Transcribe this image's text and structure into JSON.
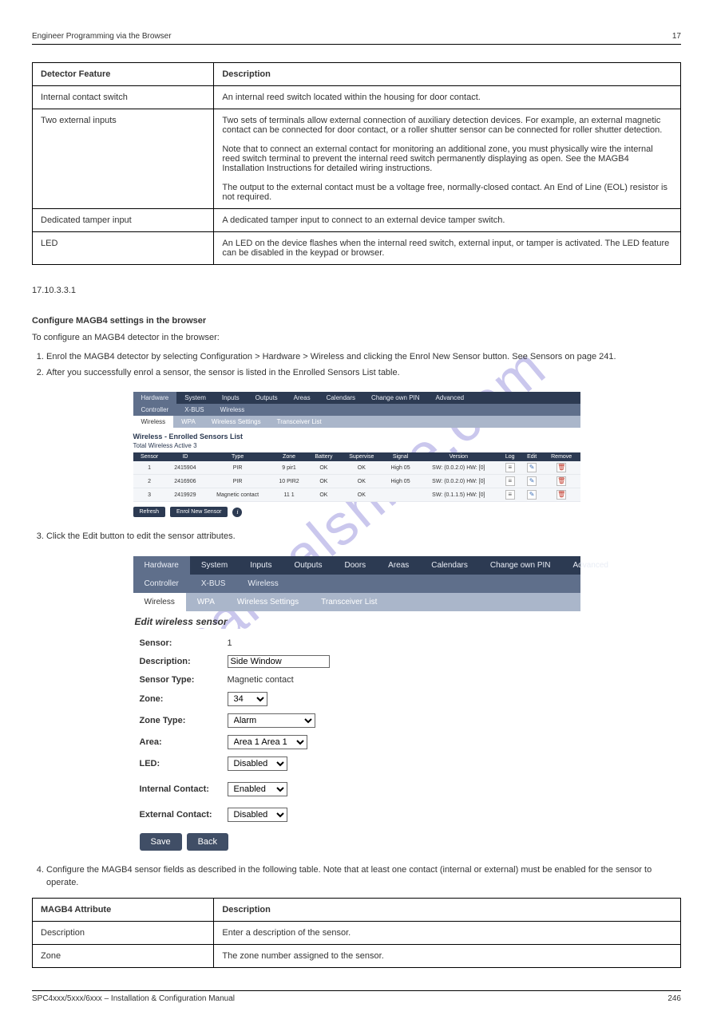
{
  "header": {
    "left": "Engineer Programming via the Browser",
    "right": "17"
  },
  "watermark": "manualshive.com",
  "table1": {
    "cols": [
      "Detector Feature",
      "Description"
    ],
    "rows": [
      [
        "Internal contact switch",
        "An internal reed switch located within the housing for door contact."
      ],
      [
        "Two external inputs",
        "Two sets of terminals allow external connection of auxiliary detection devices. For example, an external magnetic contact can be connected for door contact, or a roller shutter sensor can be connected for roller shutter detection.\n\nNote that to connect an external contact for monitoring an additional zone, you must physically wire the internal reed switch terminal to prevent the internal reed switch permanently displaying as open. See the MAGB4 Installation Instructions for detailed wiring instructions.\n\nThe output to the external contact must be a voltage free, normally-closed contact. An End of Line (EOL) resistor is not required."
      ],
      [
        "Dedicated tamper input",
        "A dedicated tamper input to connect to an external device tamper switch."
      ],
      [
        "LED",
        "An LED on the device flashes when the internal reed switch, external input, or tamper is activated. The LED feature can be disabled in the keypad or browser."
      ]
    ]
  },
  "section_label": "17.10.3.3.1",
  "section_title": "Configure MAGB4 settings in the browser",
  "intro": "To configure an MAGB4 detector in the browser:",
  "steps": [
    "Enrol the MAGB4 detector by selecting Configuration > Hardware > Wireless and clicking the Enrol New Sensor button. See Sensors on page 241.",
    "After you successfully enrol a sensor, the sensor is listed in the Enrolled Sensors List table."
  ],
  "screenshot1": {
    "nav1": [
      "Hardware",
      "System",
      "Inputs",
      "Outputs",
      "Areas",
      "Calendars",
      "Change own PIN",
      "Advanced"
    ],
    "nav1_active": "Hardware",
    "nav2": [
      "Controller",
      "X-BUS",
      "Wireless"
    ],
    "nav2_active": "Wireless",
    "nav3": [
      "Wireless",
      "WPA",
      "Wireless Settings",
      "Transceiver List"
    ],
    "nav3_active": "Wireless",
    "title": "Wireless - Enrolled Sensors List",
    "sub": "Total Wireless Active 3",
    "cols": [
      "Sensor",
      "ID",
      "Type",
      "Zone",
      "Battery",
      "Supervise",
      "Signal",
      "Version",
      "Log",
      "Edit",
      "Remove"
    ],
    "rows": [
      {
        "sensor": "1",
        "id": "2415904",
        "type": "PIR",
        "zone": "9 pir1",
        "battery": "OK",
        "supervise": "OK",
        "signal": "High 05",
        "version": "SW: (0.0.2.0) HW: [0]"
      },
      {
        "sensor": "2",
        "id": "2416906",
        "type": "PIR",
        "zone": "10 PIR2",
        "battery": "OK",
        "supervise": "OK",
        "signal": "High 05",
        "version": "SW: (0.0.2.0) HW: [0]"
      },
      {
        "sensor": "3",
        "id": "2419929",
        "type": "Magnetic contact",
        "zone": "11 1",
        "battery": "OK",
        "supervise": "OK",
        "signal": "",
        "version": "SW: (0.1.1.5) HW: [0]"
      }
    ],
    "btn_refresh": "Refresh",
    "btn_enrol": "Enrol New Sensor"
  },
  "step3": "Click the Edit button to edit the sensor attributes.",
  "screenshot2": {
    "nav1": [
      "Hardware",
      "System",
      "Inputs",
      "Outputs",
      "Doors",
      "Areas",
      "Calendars",
      "Change own PIN",
      "Advanced"
    ],
    "nav1_active": "Hardware",
    "nav2": [
      "Controller",
      "X-BUS",
      "Wireless"
    ],
    "nav2_active": "Wireless",
    "nav3": [
      "Wireless",
      "WPA",
      "Wireless Settings",
      "Transceiver List"
    ],
    "nav3_active": "Wireless",
    "title": "Edit wireless sensor",
    "fields": {
      "sensor_lbl": "Sensor:",
      "sensor_val": "1",
      "desc_lbl": "Description:",
      "desc_val": "Side Window",
      "stype_lbl": "Sensor Type:",
      "stype_val": "Magnetic contact",
      "zone_lbl": "Zone:",
      "zone_val": "34",
      "ztype_lbl": "Zone Type:",
      "ztype_val": "Alarm",
      "area_lbl": "Area:",
      "area_val": "Area 1 Area 1",
      "led_lbl": "LED:",
      "led_val": "Disabled",
      "intc_lbl": "Internal Contact:",
      "intc_val": "Enabled",
      "extc_lbl": "External Contact:",
      "extc_val": "Disabled"
    },
    "btn_save": "Save",
    "btn_back": "Back"
  },
  "step4": "Configure the MAGB4 sensor fields as described in the following table. Note that at least one contact (internal or external) must be enabled for the sensor to operate.",
  "table2": {
    "cols": [
      "MAGB4 Attribute",
      "Description"
    ],
    "rows": [
      [
        "Description",
        "Enter a description of the sensor."
      ],
      [
        "Zone",
        "The zone number assigned to the sensor."
      ]
    ]
  },
  "footer": {
    "left": "SPC4xxx/5xxx/6xxx – Installation & Configuration Manual",
    "right": "246"
  }
}
